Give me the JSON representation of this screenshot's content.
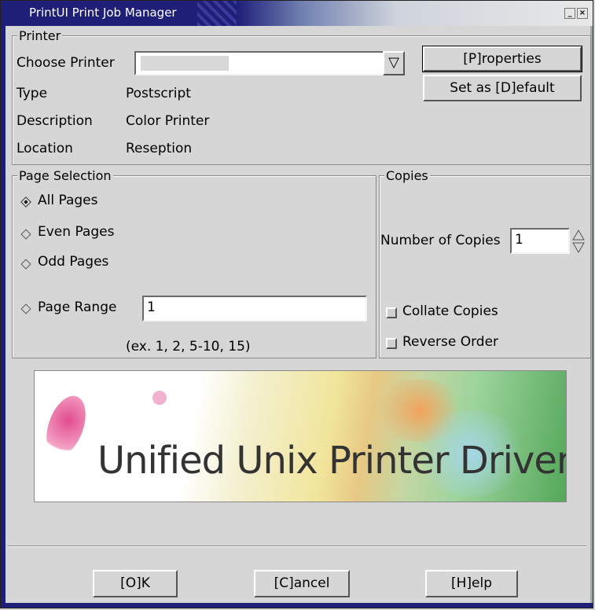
{
  "window": {
    "title": "PrintUI Print Job Manager",
    "minimize": "_",
    "close": "×"
  },
  "printer": {
    "group_label": "Printer",
    "choose_label": "Choose Printer",
    "choose_value": "",
    "type_label": "Type",
    "type_value": "Postscript",
    "description_label": "Description",
    "description_value": "Color Printer",
    "location_label": "Location",
    "location_value": "Reseption",
    "properties_button": "[P]roperties",
    "default_button": "Set as [D]efault"
  },
  "page_selection": {
    "group_label": "Page Selection",
    "options": [
      "All Pages",
      "Even Pages",
      "Odd Pages",
      "Page Range"
    ],
    "selected": "All Pages",
    "range_value": "1",
    "range_hint": "(ex. 1, 2, 5-10, 15)"
  },
  "copies": {
    "group_label": "Copies",
    "number_label": "Number of Copies",
    "number_value": "1",
    "collate_label": "Collate Copies",
    "collate_checked": false,
    "reverse_label": "Reverse Order",
    "reverse_checked": false
  },
  "logo": {
    "text": "Unified Unix Printer Driver"
  },
  "buttons": {
    "ok": "[O]K",
    "cancel": "[C]ancel",
    "help": "[H]elp"
  },
  "colors": {
    "titlebar": "#1f1f78",
    "dialog_bg": "#d6d6d6"
  }
}
